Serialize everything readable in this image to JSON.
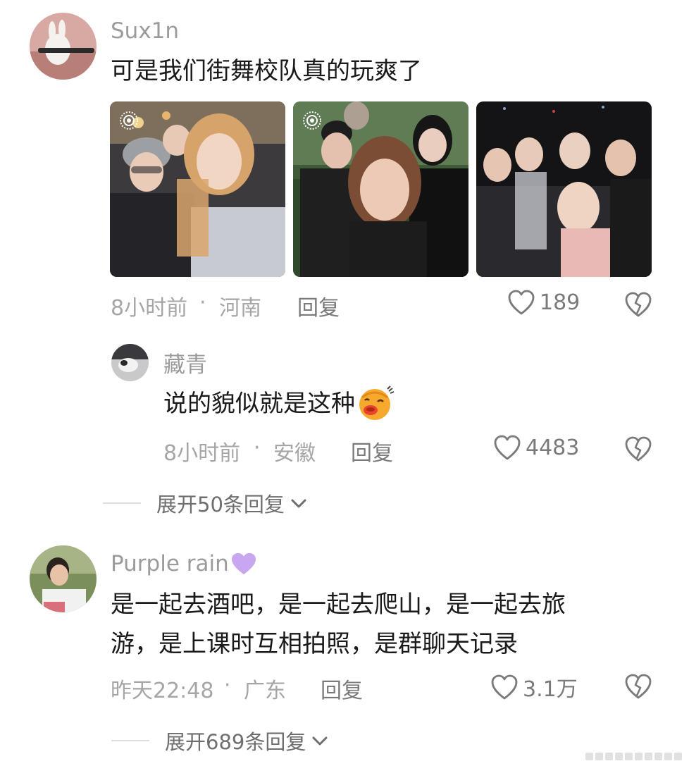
{
  "comments": [
    {
      "username": "Sux1n",
      "text": "可是我们街舞校队真的玩爽了",
      "time": "8小时前",
      "location": "河南",
      "reply_label": "回复",
      "likes": "189",
      "replies": [
        {
          "username": "藏青",
          "text": "说的貌似就是这种",
          "emoji": "kissing-face-emoji",
          "time": "8小时前",
          "location": "安徽",
          "reply_label": "回复",
          "likes": "4483"
        }
      ],
      "expand_label": "展开50条回复"
    },
    {
      "username": "Purple rain",
      "username_badge": "purple-heart-icon",
      "text_lines": [
        "是一起去酒吧，是一起去爬山，是一起去旅",
        "游，是上课时互相拍照，是群聊天记录"
      ],
      "time": "昨天22:48",
      "location": "广东",
      "reply_label": "回复",
      "likes": "3.1万",
      "expand_label": "展开689条回复"
    }
  ],
  "separator": "·",
  "icons": {
    "like": "heart-outline-icon",
    "dislike": "broken-heart-icon",
    "expand": "chevron-down-icon",
    "live_photo": "live-photo-icon"
  },
  "colors": {
    "meta_text": "#a6a6a6",
    "body_text": "#1a1a1a",
    "username_text": "#9b9b9b",
    "purple_heart": "#c9a6f0"
  }
}
